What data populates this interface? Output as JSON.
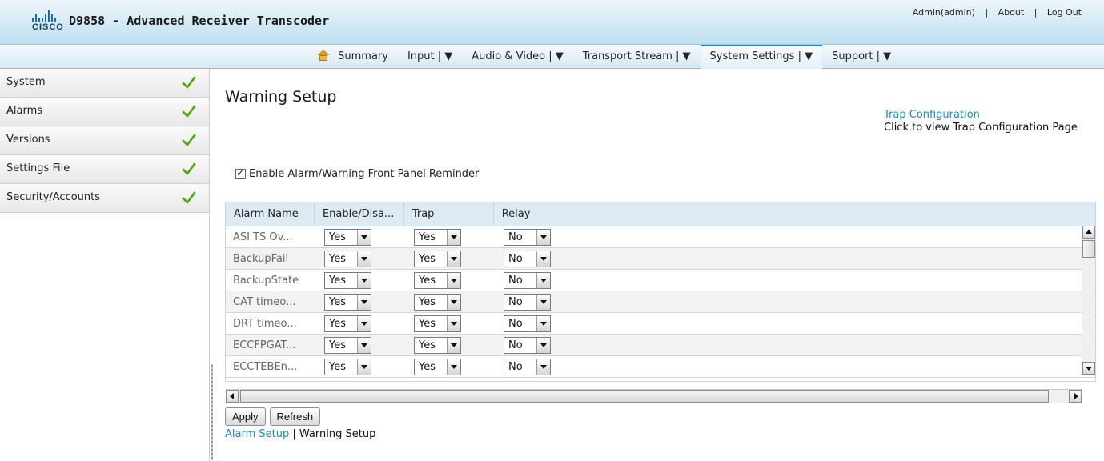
{
  "header": {
    "logo_text": "CISCO",
    "app_title": "D9858 - Advanced Receiver Transcoder",
    "user_label": "Admin(admin)",
    "about_label": "About",
    "logout_label": "Log Out",
    "separator": "|"
  },
  "nav": {
    "items": [
      {
        "label": "Summary"
      },
      {
        "label": "Input | ▼"
      },
      {
        "label": "Audio & Video | ▼"
      },
      {
        "label": "Transport Stream | ▼"
      },
      {
        "label": "System Settings | ▼"
      },
      {
        "label": "Support | ▼"
      }
    ],
    "active": "System Settings"
  },
  "sidebar": {
    "items": [
      {
        "label": "System"
      },
      {
        "label": "Alarms"
      },
      {
        "label": "Versions"
      },
      {
        "label": "Settings File"
      },
      {
        "label": "Security/Accounts"
      }
    ]
  },
  "main": {
    "title": "Warning Setup",
    "trap_link": "Trap Configuration",
    "trap_desc": "Click to view Trap Configuration Page",
    "reminder_label": "Enable Alarm/Warning Front Panel Reminder",
    "reminder_checked": true,
    "table": {
      "columns": [
        "Alarm Name",
        "Enable/Disa...",
        "Trap",
        "Relay"
      ],
      "rows": [
        {
          "name": "ASI TS Ov...",
          "enable": "Yes",
          "trap": "Yes",
          "relay": "No"
        },
        {
          "name": "BackupFail",
          "enable": "Yes",
          "trap": "Yes",
          "relay": "No"
        },
        {
          "name": "BackupState",
          "enable": "Yes",
          "trap": "Yes",
          "relay": "No"
        },
        {
          "name": "CAT timeo...",
          "enable": "Yes",
          "trap": "Yes",
          "relay": "No"
        },
        {
          "name": "DRT timeo...",
          "enable": "Yes",
          "trap": "Yes",
          "relay": "No"
        },
        {
          "name": "ECCFPGAT...",
          "enable": "Yes",
          "trap": "Yes",
          "relay": "No"
        },
        {
          "name": "ECCTEBEn...",
          "enable": "Yes",
          "trap": "Yes",
          "relay": "No"
        }
      ]
    },
    "apply_label": "Apply",
    "refresh_label": "Refresh",
    "footer_link": "Alarm Setup",
    "footer_sep": "|",
    "footer_current": "Warning Setup"
  },
  "colors": {
    "accent": "#1b8ac4",
    "check_green": "#6cc12e",
    "header_bg": "#d3e9f5",
    "table_header_bg": "#dde9f3"
  },
  "icons": {
    "home": "home-icon",
    "check": "check-icon",
    "dropdown": "chevron-down-icon"
  }
}
